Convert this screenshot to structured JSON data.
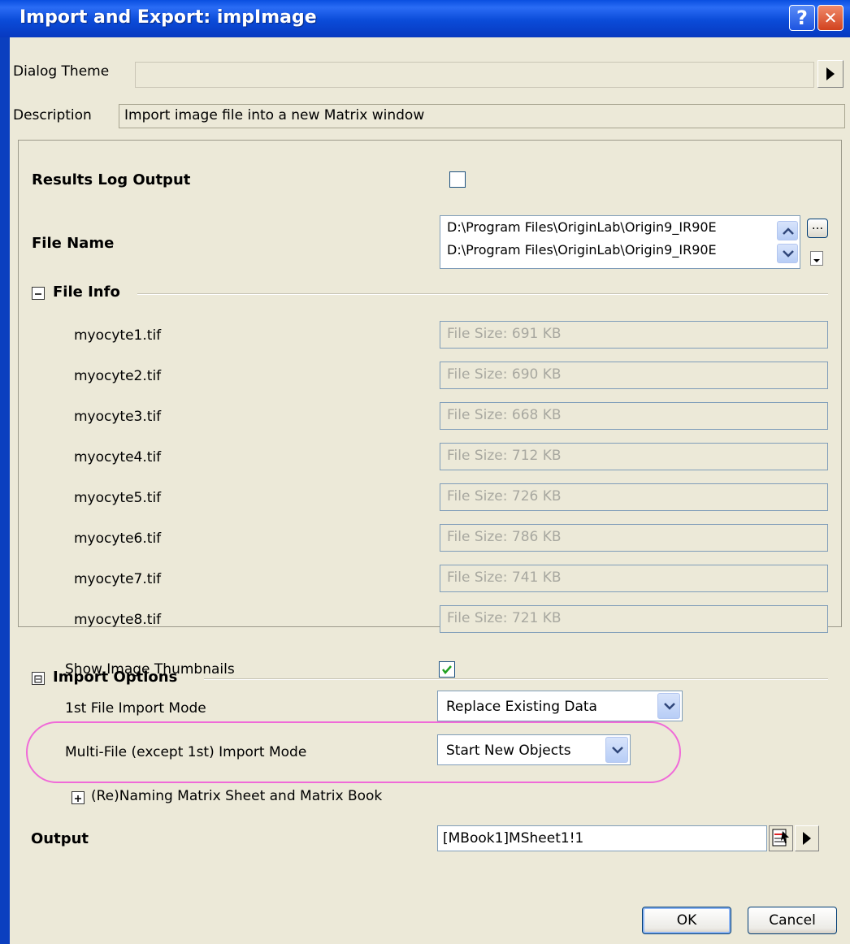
{
  "window": {
    "title": "Import and Export: impImage",
    "help_glyph": "?",
    "close_glyph": "✕"
  },
  "theme": {
    "label": "Dialog Theme",
    "value": ""
  },
  "description": {
    "label": "Description",
    "value": "Import image file into a new Matrix window"
  },
  "results_log": {
    "label": "Results Log Output",
    "checked": false
  },
  "file_name": {
    "label": "File Name",
    "lines": [
      "D:\\Program Files\\OriginLab\\Origin9_IR90E",
      "D:\\Program Files\\OriginLab\\Origin9_IR90E"
    ],
    "browse_label": "..."
  },
  "file_info": {
    "title": "File Info",
    "expanded": true,
    "files": [
      {
        "name": "myocyte1.tif",
        "size": "File Size: 691 KB"
      },
      {
        "name": "myocyte2.tif",
        "size": "File Size: 690 KB"
      },
      {
        "name": "myocyte3.tif",
        "size": "File Size: 668 KB"
      },
      {
        "name": "myocyte4.tif",
        "size": "File Size: 712 KB"
      },
      {
        "name": "myocyte5.tif",
        "size": "File Size: 726 KB"
      },
      {
        "name": "myocyte6.tif",
        "size": "File Size: 786 KB"
      },
      {
        "name": "myocyte7.tif",
        "size": "File Size: 741 KB"
      },
      {
        "name": "myocyte8.tif",
        "size": "File Size: 721 KB"
      }
    ]
  },
  "import_options": {
    "title": "Import Options",
    "show_thumbnails": {
      "label": "Show Image Thumbnails",
      "checked": true
    },
    "first_file_mode": {
      "label": "1st File Import Mode",
      "value": "Replace Existing Data"
    },
    "multi_file_mode": {
      "label": "Multi-File (except 1st) Import Mode",
      "value": "Start New Objects"
    },
    "renaming": {
      "label": "(Re)Naming Matrix Sheet and Matrix Book"
    }
  },
  "output": {
    "label": "Output",
    "value": "[MBook1]MSheet1!1"
  },
  "buttons": {
    "ok": "OK",
    "cancel": "Cancel"
  },
  "colors": {
    "title_bar": "#0b4bd8",
    "dialog_bg": "#ece9d8",
    "highlight": "#f06ad8",
    "check_mark": "#21a121"
  }
}
